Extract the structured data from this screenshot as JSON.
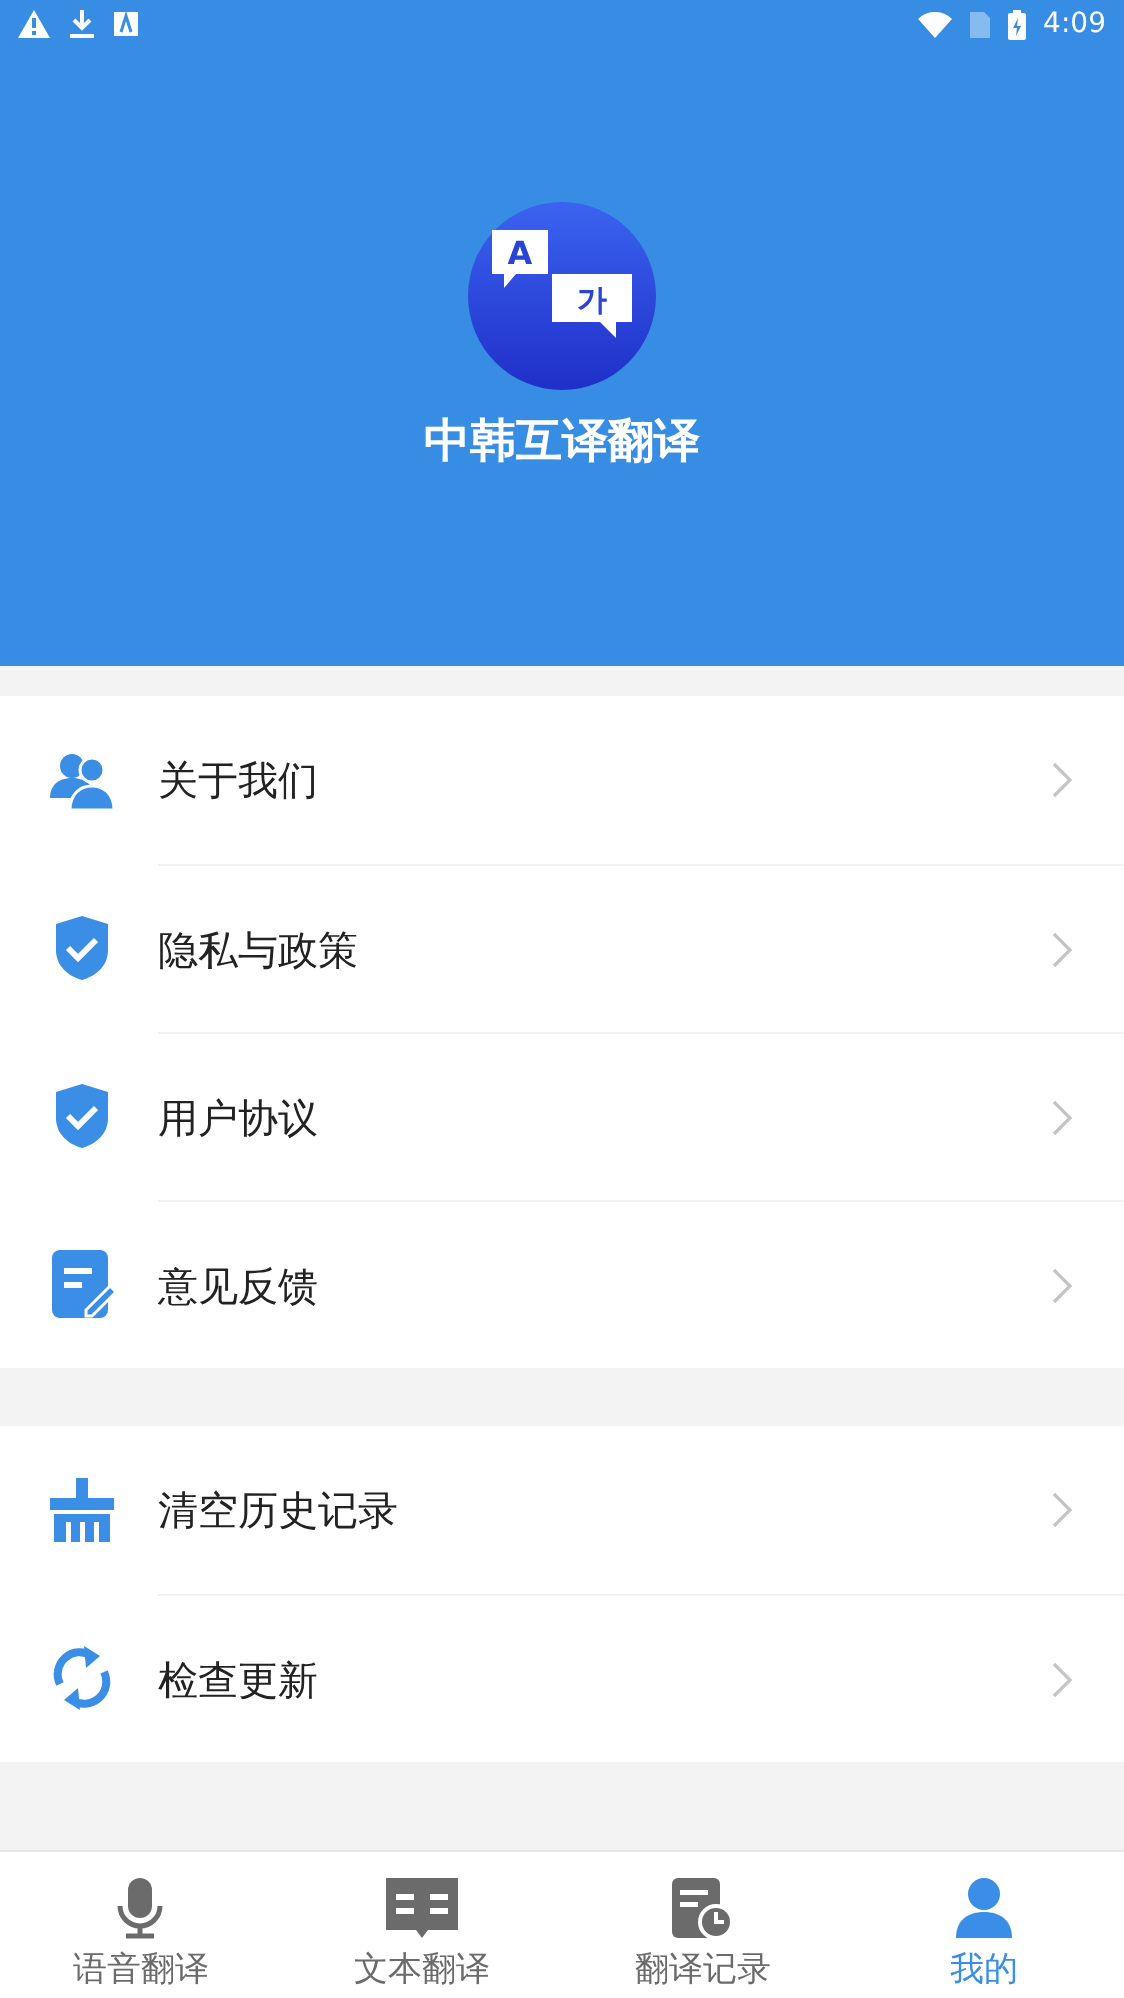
{
  "status_bar": {
    "time": "4:09"
  },
  "header": {
    "app_name": "中韩互译翻译",
    "logo_letters": [
      "A",
      "가"
    ]
  },
  "groups": [
    {
      "items": [
        {
          "kind": "users",
          "label": "关于我们"
        },
        {
          "kind": "shield",
          "label": "隐私与政策"
        },
        {
          "kind": "shield",
          "label": "用户协议"
        },
        {
          "kind": "feedback",
          "label": "意见反馈"
        }
      ]
    },
    {
      "items": [
        {
          "kind": "broom",
          "label": "清空历史记录"
        },
        {
          "kind": "refresh",
          "label": "检查更新"
        }
      ]
    }
  ],
  "tabs": [
    {
      "kind": "mic",
      "label": "语音翻译",
      "selected": false
    },
    {
      "kind": "book",
      "label": "文本翻译",
      "selected": false
    },
    {
      "kind": "history",
      "label": "翻译记录",
      "selected": false
    },
    {
      "kind": "me",
      "label": "我的",
      "selected": true
    }
  ]
}
